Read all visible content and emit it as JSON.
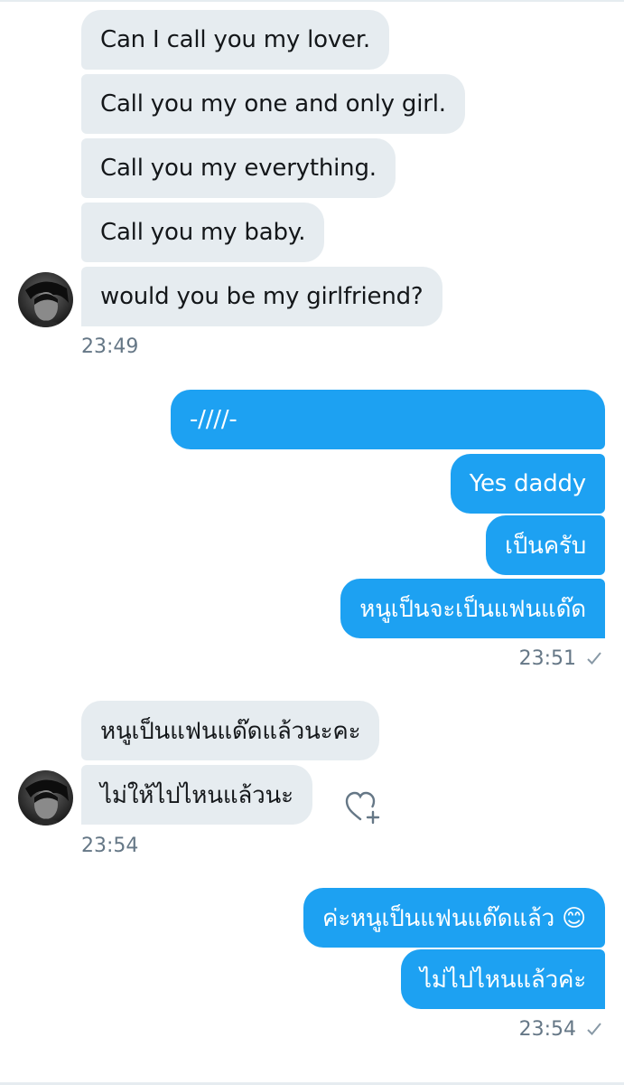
{
  "conversation": {
    "group1": {
      "messages": [
        "Can I call you my lover.",
        "Call you my one and only girl.",
        "Call you my everything.",
        "Call you my baby.",
        "would you be my girlfriend?"
      ],
      "time": "23:49"
    },
    "group2": {
      "messages": [
        "-////-",
        "Yes daddy",
        "เป็นครับ",
        "หนูเป็นจะเป็นแฟนแด๊ด"
      ],
      "time": "23:51"
    },
    "group3": {
      "messages": [
        "หนูเป็นแฟนแด๊ดแล้วนะคะ",
        "ไม่ให้ไปไหนแล้วนะ"
      ],
      "time": "23:54"
    },
    "group4": {
      "messages": [
        "ค่ะหนูเป็นแฟนแด๊ดแล้ว 😊",
        "ไม่ไปไหนแล้วค่ะ"
      ],
      "time": "23:54"
    }
  },
  "icons": {
    "read_receipt": "check-icon",
    "reaction": "heart-plus-icon",
    "avatar": "user-avatar"
  },
  "colors": {
    "sent_bubble": "#1da1f2",
    "received_bubble": "#e6ecf0",
    "timestamp": "#657786"
  }
}
